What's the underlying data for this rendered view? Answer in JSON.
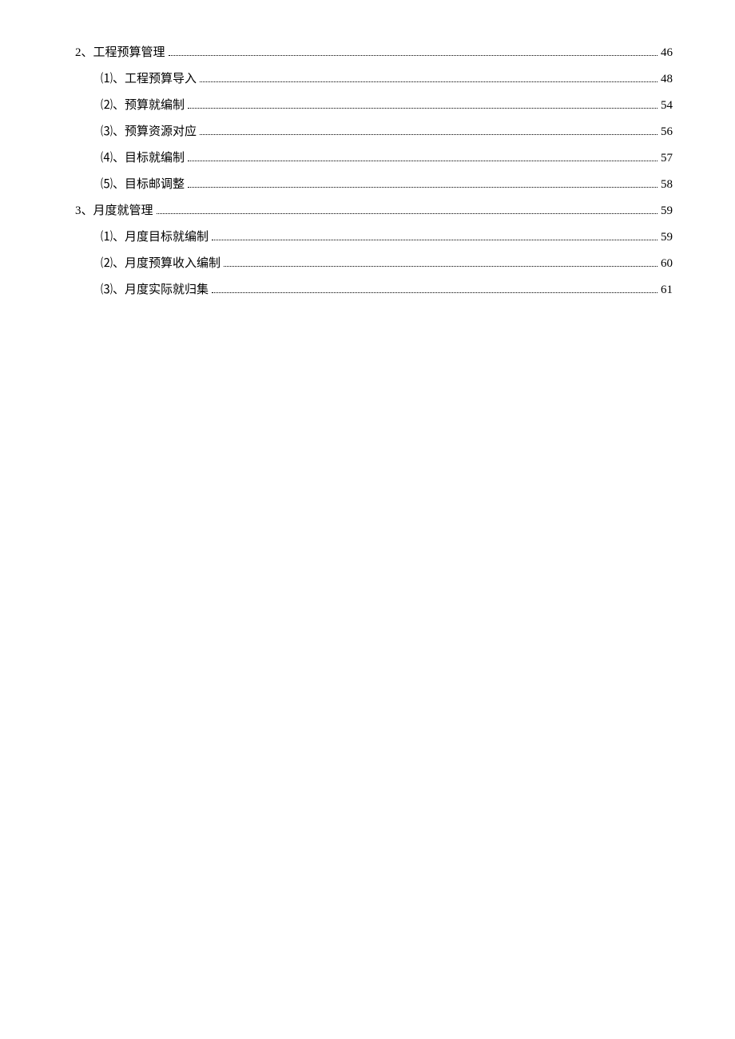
{
  "toc": [
    {
      "level": 1,
      "label": "2、工程预算管理",
      "page": "46"
    },
    {
      "level": 2,
      "label": "⑴、工程预算导入",
      "page": "48"
    },
    {
      "level": 2,
      "label": "⑵、预算就编制",
      "page": "54"
    },
    {
      "level": 2,
      "label": "⑶、预算资源对应",
      "page": "56"
    },
    {
      "level": 2,
      "label": "⑷、目标就编制",
      "page": "57"
    },
    {
      "level": 2,
      "label": "⑸、目标邮调整",
      "page": "58"
    },
    {
      "level": 1,
      "label": "3、月度就管理",
      "page": "59"
    },
    {
      "level": 2,
      "label": "⑴、月度目标就编制",
      "page": "59"
    },
    {
      "level": 2,
      "label": "⑵、月度预算收入编制",
      "page": "60"
    },
    {
      "level": 2,
      "label": "⑶、月度实际就归集",
      "page": "61"
    }
  ]
}
